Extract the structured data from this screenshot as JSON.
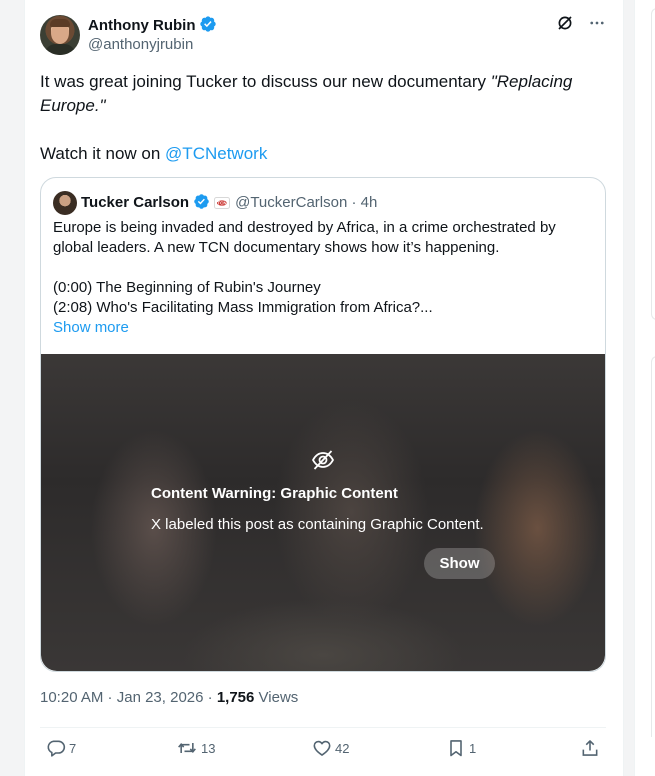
{
  "author": {
    "name": "Anthony Rubin",
    "handle": "@anthonyjrubin"
  },
  "tweet": {
    "text_line1": "It was great joining Tucker to discuss our new documentary ",
    "text_italic": "\"Replacing Europe.\"",
    "text_line2": "Watch it now on ",
    "mention": "@TCNetwork"
  },
  "quote": {
    "name": "Tucker Carlson",
    "handle": "@TuckerCarlson",
    "separator": "·",
    "time": "4h",
    "body_line1": "Europe is being invaded and destroyed by Africa, in a crime orchestrated by global leaders. A new TCN documentary shows how it’s happening.",
    "chapter1": "(0:00) The Beginning of Rubin's Journey",
    "chapter2": "(2:08) Who's Facilitating Mass Immigration from Africa?...",
    "show_more": "Show more",
    "warning_title": "Content Warning: Graphic Content",
    "warning_text": "X labeled this post as containing Graphic Content.",
    "show_button": "Show"
  },
  "meta": {
    "time": "10:20 AM",
    "dot1": " · ",
    "date": "Jan 23, 2026",
    "dot2": " · ",
    "views_count": "1,756",
    "views_label": " Views"
  },
  "actions": {
    "replies": "7",
    "reposts": "13",
    "likes": "42",
    "bookmarks": "1"
  },
  "icons": {
    "top": [
      "grok-icon",
      "more-icon"
    ],
    "actions": [
      "reply-icon",
      "repost-icon",
      "like-icon",
      "bookmark-icon",
      "share-icon"
    ]
  },
  "colors": {
    "accent": "#1d9bf0",
    "muted": "#536471"
  }
}
